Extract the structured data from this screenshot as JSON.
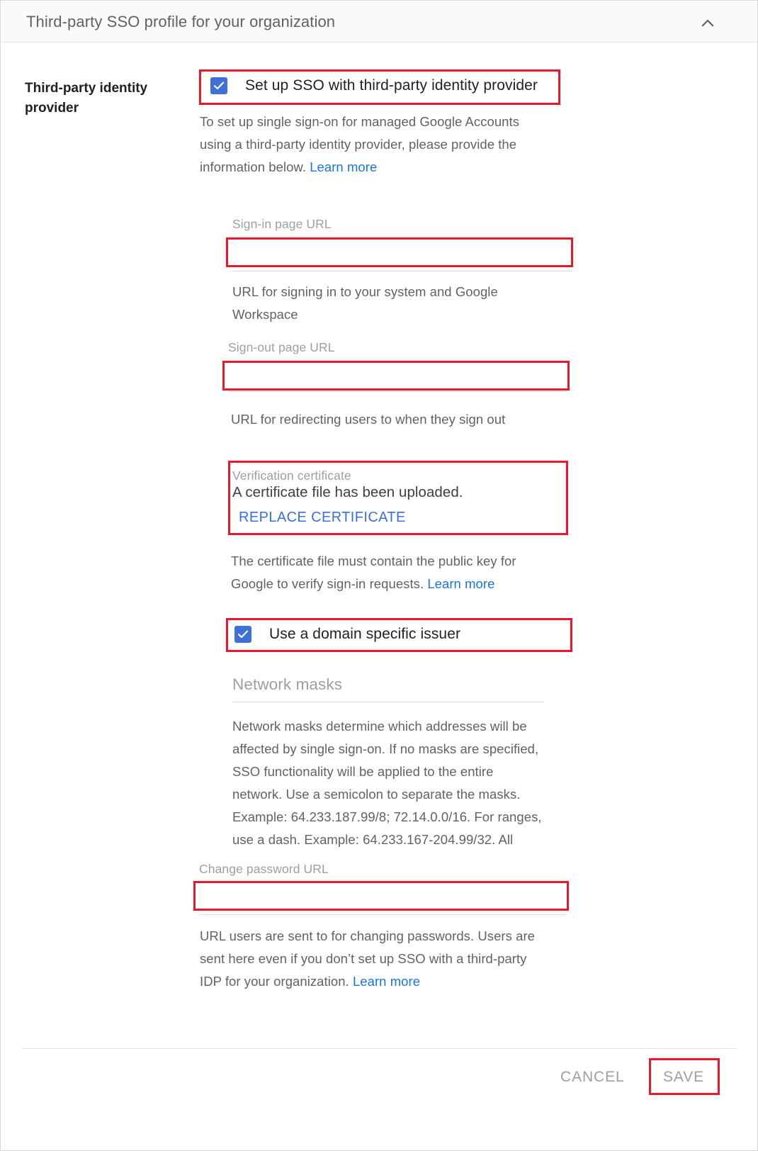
{
  "header": {
    "title": "Third-party SSO profile for your organization",
    "collapse_icon": "chevron-up-icon"
  },
  "section": {
    "label": "Third-party identity provider"
  },
  "sso_checkbox": {
    "label": "Set up SSO with third-party identity provider",
    "checked": true,
    "icon": "checkmark-icon"
  },
  "sso_description": {
    "line1": "To set up single sign-on for managed Google Accounts",
    "line2": "using a third-party identity provider, please provide the",
    "line3": "information below. ",
    "link": "Learn more"
  },
  "signin_field": {
    "label": "Sign-in page URL",
    "value": "",
    "placeholder": "",
    "helper_line1": "URL for signing in to your system and Google",
    "helper_line2": "Workspace"
  },
  "signout_field": {
    "label": "Sign-out page URL",
    "value": "",
    "placeholder": "",
    "helper": "URL for redirecting users to when they sign out"
  },
  "certificate": {
    "caption": "Verification certificate",
    "status": "A certificate file has been uploaded.",
    "action": "REPLACE CERTIFICATE",
    "helper_line1": "The certificate file must contain the public key for",
    "helper_line2": "Google to verify sign-in requests. ",
    "link": "Learn more"
  },
  "domain_issuer_checkbox": {
    "label": "Use a domain specific issuer",
    "checked": true,
    "icon": "checkmark-icon"
  },
  "network_masks": {
    "title": "Network masks",
    "value": "",
    "helper_line1": "Network masks determine which addresses will be",
    "helper_line2": "affected by single sign-on. If no masks are specified,",
    "helper_line3": "SSO functionality will be applied to the entire",
    "helper_line4": "network. Use a semicolon to separate the masks.",
    "helper_line5": "Example: 64.233.187.99/8; 72.14.0.0/16. For ranges,",
    "helper_line6": "use a dash. Example: 64.233.167-204.99/32. All"
  },
  "change_password_field": {
    "label": "Change password URL",
    "value": "",
    "placeholder": "",
    "helper_line1": "URL users are sent to for changing passwords. Users are",
    "helper_line2": "sent here even if you don’t set up SSO with a third-party",
    "helper_line3": "IDP for your organization. ",
    "link": "Learn more"
  },
  "footer": {
    "cancel_label": "CANCEL",
    "save_label": "SAVE"
  },
  "colors": {
    "accent_blue": "#1a73e8",
    "checkbox_blue": "#3f6fd8",
    "highlight_red": "#e8192c",
    "text_primary": "#202124",
    "text_secondary": "#5f6368",
    "text_muted": "#9aa0a6"
  }
}
